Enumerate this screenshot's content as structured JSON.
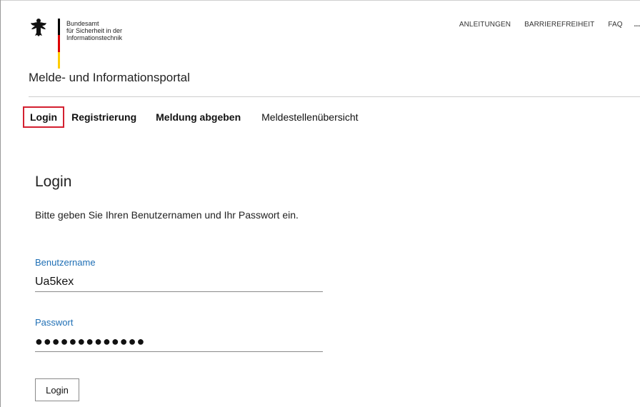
{
  "header": {
    "logo": {
      "line1": "Bundesamt",
      "line2": "für Sicherheit in der",
      "line3": "Informationstechnik",
      "flag_colors": [
        "#000000",
        "#dd0000",
        "#ffcc00"
      ]
    },
    "meta_nav": {
      "items": [
        "ANLEITUNGEN",
        "BARRIEREFREIHEIT",
        "FAQ"
      ],
      "more_label": "..."
    },
    "site_title": "Melde- und Informationsportal"
  },
  "main_nav": {
    "login": "Login",
    "registrierung": "Registrierung",
    "meldung": "Meldung abgeben",
    "uebersicht": "Meldestellenübersicht",
    "highlight_color": "#d32030"
  },
  "login_form": {
    "title": "Login",
    "intro": "Bitte geben Sie Ihren Benutzernamen und Ihr Passwort ein.",
    "username_label": "Benutzername",
    "username_value": "Ua5kex",
    "password_label": "Passwort",
    "password_value": "●●●●●●●●●●●●●",
    "submit_label": "Login",
    "label_color": "#1f6fb5"
  }
}
